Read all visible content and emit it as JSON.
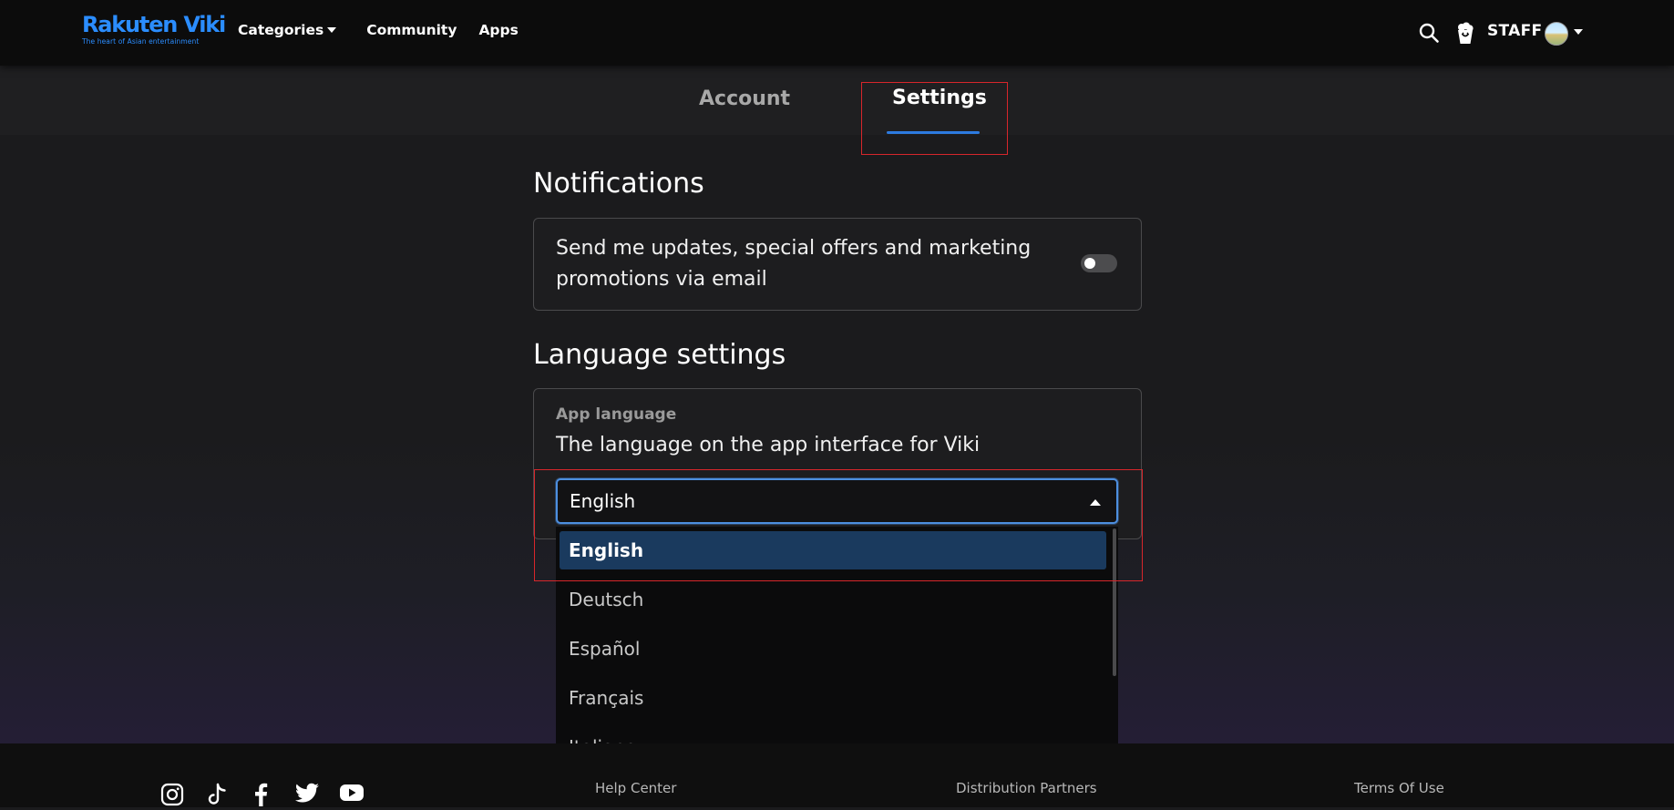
{
  "header": {
    "logo_main": "Rakuten Viki",
    "logo_tagline": "The heart of Asian entertainment",
    "nav": [
      {
        "label": "Categories"
      },
      {
        "label": "Community"
      },
      {
        "label": "Apps"
      }
    ],
    "user_label": "STAFF",
    "icons": [
      "search-icon",
      "popcorn-icon",
      "avatar",
      "chevron-down-icon"
    ]
  },
  "tabs": [
    {
      "label": "Account",
      "active": false
    },
    {
      "label": "Settings",
      "active": true
    }
  ],
  "notifications": {
    "title": "Notifications",
    "text": "Send me updates, special offers and marketing promotions via email",
    "toggle_on": false
  },
  "language": {
    "title": "Language settings",
    "label": "App language",
    "description": "The language on the app interface for Viki",
    "selected": "English",
    "options": [
      "English",
      "Deutsch",
      "Español",
      "Français",
      "Italiano"
    ]
  },
  "footer": {
    "social_icons": [
      "instagram-icon",
      "tiktok-icon",
      "facebook-icon",
      "twitter-icon",
      "youtube-icon"
    ],
    "links": [
      "Help Center",
      "Distribution Partners",
      "Terms Of Use"
    ]
  },
  "colors": {
    "brand": "#2b8dff",
    "accent": "#2d7be0",
    "highlight": "#d7262b",
    "selected_option": "#1a3a5e"
  }
}
